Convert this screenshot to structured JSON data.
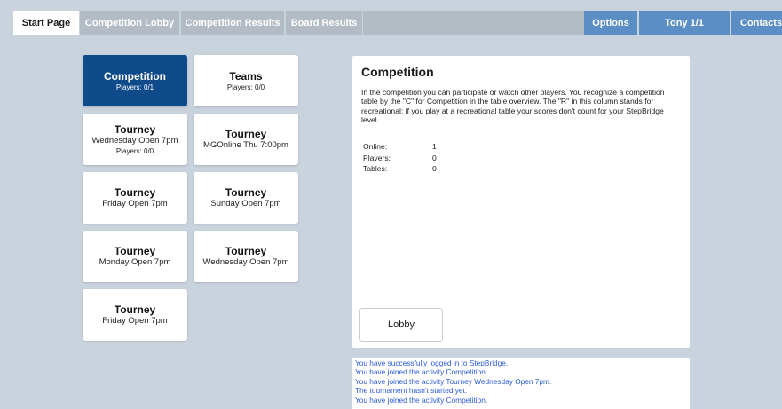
{
  "tabs": [
    {
      "label": "Start Page"
    },
    {
      "label": "Competition Lobby"
    },
    {
      "label": "Competition Results"
    },
    {
      "label": "Board Results"
    },
    {
      "label": "Options"
    },
    {
      "label": "Tony 1/1"
    },
    {
      "label": "Contacts"
    }
  ],
  "cards": [
    {
      "title": "Competition",
      "subtitle": "Players: 0/1",
      "detail": ""
    },
    {
      "title": "Teams",
      "subtitle": "Players: 0/0",
      "detail": ""
    },
    {
      "title": "Tourney",
      "subtitle": "Wednesday Open 7pm",
      "detail": "Players: 0/0"
    },
    {
      "title": "Tourney",
      "subtitle": "MGOnline Thu 7:00pm",
      "detail": ""
    },
    {
      "title": "Tourney",
      "subtitle": "Friday Open 7pm",
      "detail": ""
    },
    {
      "title": "Tourney",
      "subtitle": "Sunday Open 7pm",
      "detail": ""
    },
    {
      "title": "Tourney",
      "subtitle": "Monday Open 7pm",
      "detail": ""
    },
    {
      "title": "Tourney",
      "subtitle": "Wednesday Open 7pm",
      "detail": ""
    },
    {
      "title": "Tourney",
      "subtitle": "Friday Open 7pm",
      "detail": ""
    }
  ],
  "panel": {
    "title": "Competition",
    "description": "In the competition you can participate or watch other players. You recognize a competition table by the \"C\" for Competition in the table overview. The \"R\" in this column stands for recreational; if you play at a recreational table your scores don't count for your StepBridge level.",
    "stats": [
      {
        "label": "Online:",
        "value": "1"
      },
      {
        "label": "Players:",
        "value": "0"
      },
      {
        "label": "Tables:",
        "value": "0"
      }
    ],
    "lobby_button": "Lobby"
  },
  "log": [
    "You have successfully logged in to StepBridge.",
    "You have joined the activity Competition.",
    "You have joined the activity Tourney Wednesday Open 7pm.",
    "The tournament hasn't started yet.",
    "You have joined the activity Competition."
  ],
  "colors": {
    "background": "#c9d3de",
    "selected_card": "#0f4a8a",
    "tab_grey": "#b3bbc4",
    "tab_blue": "#5b8ec4",
    "log_text": "#2a5ad8"
  }
}
